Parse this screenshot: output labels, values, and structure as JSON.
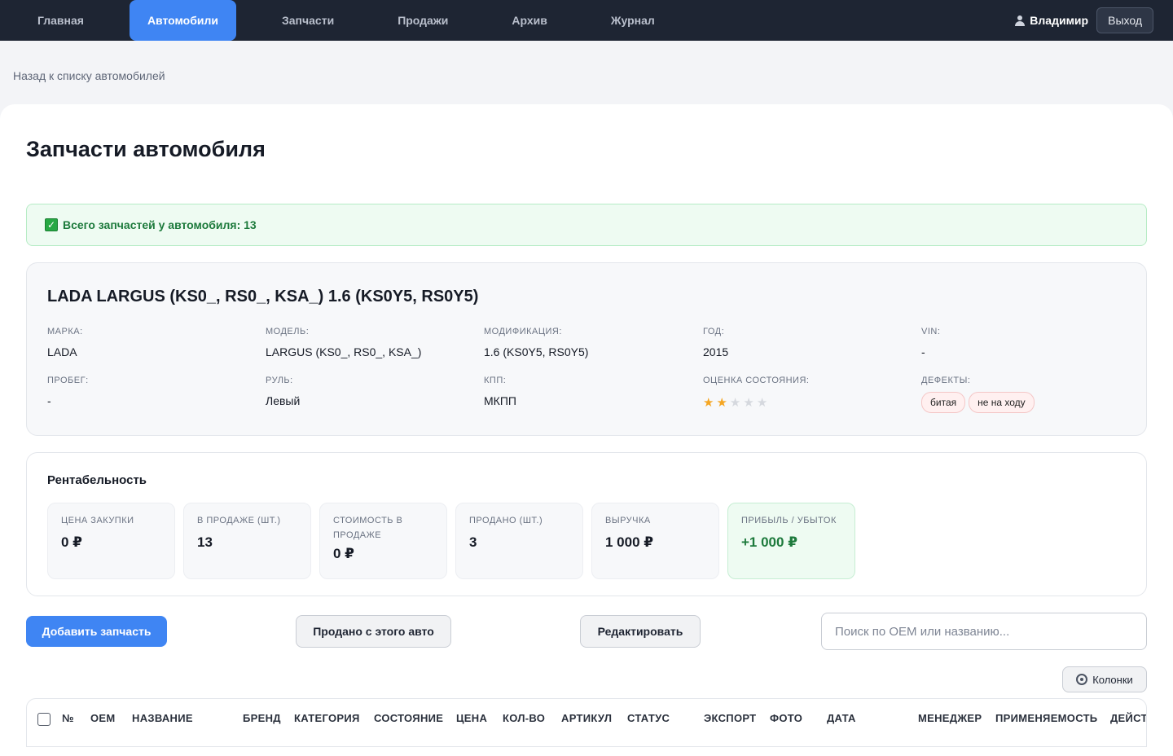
{
  "nav": {
    "items": [
      "Главная",
      "Автомобили",
      "Запчасти",
      "Продажи",
      "Архив",
      "Журнал"
    ],
    "active": "Автомобили",
    "user": "Владимир",
    "logout": "Выход"
  },
  "back_link": "Назад к списку автомобилей",
  "page_title": "Запчасти автомобиля",
  "alert": "Всего запчастей у автомобиля: 13",
  "car": {
    "title": "LADA LARGUS (KS0_, RS0_, KSA_) 1.6 (KS0Y5, RS0Y5)",
    "fields": {
      "make_label": "МАРКА:",
      "make": "LADA",
      "model_label": "МОДЕЛЬ:",
      "model": "LARGUS (KS0_, RS0_, KSA_)",
      "mod_label": "МОДИФИКАЦИЯ:",
      "mod": "1.6 (KS0Y5, RS0Y5)",
      "year_label": "ГОД:",
      "year": "2015",
      "vin_label": "VIN:",
      "vin": "-",
      "mileage_label": "ПРОБЕГ:",
      "mileage": "-",
      "wheel_label": "РУЛЬ:",
      "wheel": "Левый",
      "gearbox_label": "КПП:",
      "gearbox": "МКПП",
      "rating_label": "ОЦЕНКА СОСТОЯНИЯ:",
      "rating": 2,
      "rating_max": 5,
      "defects_label": "ДЕФЕКТЫ:",
      "defects": [
        "битая",
        "не на ходу"
      ]
    }
  },
  "profitability": {
    "title": "Рентабельность",
    "metrics": [
      {
        "label": "ЦЕНА ЗАКУПКИ",
        "value": "0 ₽"
      },
      {
        "label": "В ПРОДАЖЕ (ШТ.)",
        "value": "13"
      },
      {
        "label": "СТОИМОСТЬ В ПРОДАЖЕ",
        "value": "0 ₽"
      },
      {
        "label": "ПРОДАНО (ШТ.)",
        "value": "3"
      },
      {
        "label": "ВЫРУЧКА",
        "value": "1 000 ₽"
      },
      {
        "label": "ПРИБЫЛЬ / УБЫТОК",
        "value": "+1 000 ₽"
      }
    ]
  },
  "actions": {
    "add": "Добавить запчасть",
    "sold": "Продано с этого авто",
    "edit": "Редактировать",
    "search_placeholder": "Поиск по OEM или названию...",
    "columns": "Колонки"
  },
  "table": {
    "headers": [
      "№",
      "OEM",
      "НАЗВАНИЕ",
      "БРЕНД",
      "КАТЕГОРИЯ",
      "СОСТОЯНИЕ",
      "ЦЕНА",
      "КОЛ-ВО",
      "АРТИКУЛ",
      "СТАТУС",
      "ЭКСПОРТ",
      "ФОТО",
      "ДАТА",
      "МЕНЕДЖЕР",
      "ПРИМЕНЯЕМОСТЬ",
      "ДЕЙСТ"
    ]
  },
  "colors": {
    "nav_bg": "#1e2533",
    "accent": "#3f85f3",
    "success": "#1d7a3c",
    "star": "#f5a623"
  }
}
